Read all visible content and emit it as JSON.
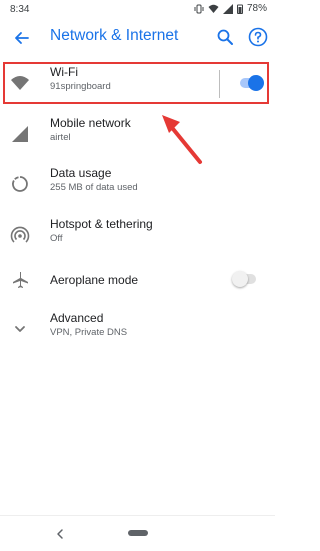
{
  "status": {
    "time": "8:34",
    "battery": "78%"
  },
  "header": {
    "title": "Network & Internet"
  },
  "items": [
    {
      "label": "Wi-Fi",
      "sub": "91springboard",
      "toggle": true
    },
    {
      "label": "Mobile network",
      "sub": "airtel"
    },
    {
      "label": "Data usage",
      "sub": "255 MB of data used"
    },
    {
      "label": "Hotspot & tethering",
      "sub": "Off"
    },
    {
      "label": "Aeroplane mode",
      "toggle": false
    },
    {
      "label": "Advanced",
      "sub": "VPN, Private DNS"
    }
  ],
  "colors": {
    "accent": "#1a73e8",
    "highlight": "#e53935",
    "toggle_on": "#1a73e8",
    "toggle_off": "#bdbdbd"
  }
}
